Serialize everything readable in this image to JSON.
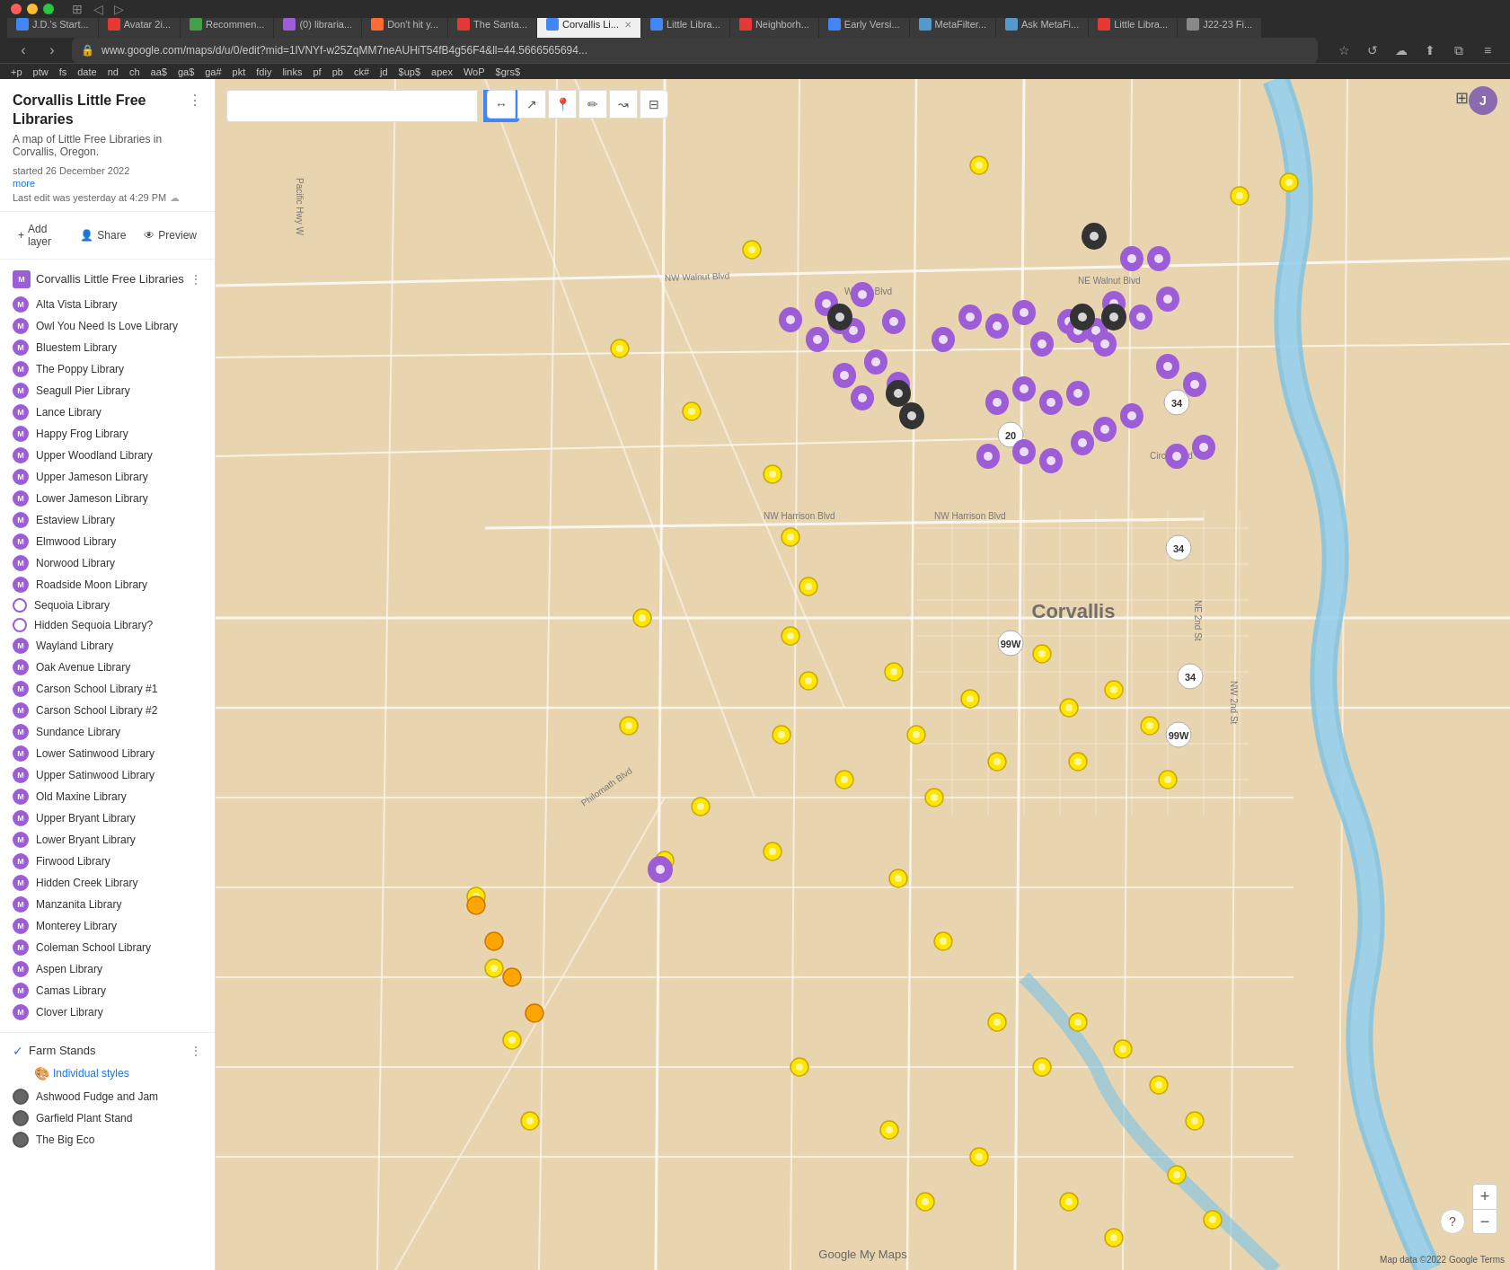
{
  "browser": {
    "tabs": [
      {
        "label": "J.D.'s Start...",
        "active": false,
        "color": "#4285f4"
      },
      {
        "label": "Avatar 2i...",
        "active": false,
        "color": "#e53935"
      },
      {
        "label": "Recommen...",
        "active": false,
        "color": "#43a047"
      },
      {
        "label": "(0) libraria...",
        "active": false,
        "color": "#9c5dd7"
      },
      {
        "label": "Don't hit y...",
        "active": false,
        "color": "#ff6b35"
      },
      {
        "label": "The Santa...",
        "active": false,
        "color": "#e53935"
      },
      {
        "label": "Corvallis Li...",
        "active": true,
        "color": "#4285f4"
      },
      {
        "label": "Little Libra...",
        "active": false,
        "color": "#4285f4"
      },
      {
        "label": "Neighborh...",
        "active": false,
        "color": "#e53935"
      },
      {
        "label": "Early Versi...",
        "active": false,
        "color": "#4285f4"
      },
      {
        "label": "MetaFilter...",
        "active": false,
        "color": "#5599cc"
      },
      {
        "label": "Ask MetaFi...",
        "active": false,
        "color": "#5599cc"
      },
      {
        "label": "Little Libra...",
        "active": false,
        "color": "#e53935"
      },
      {
        "label": "J22-23 Fi...",
        "active": false,
        "color": "#888"
      }
    ],
    "address": "www.google.com/maps/d/u/0/edit?mid=1lVNYf-w25ZqMM7neAUHiT54fB4g56F4&ll=44.5666565694...",
    "bookmarks": [
      "+p",
      "ptw",
      "fs",
      "date",
      "nd",
      "ch",
      "aa$",
      "ga$",
      "ga#",
      "pkt",
      "fdiy",
      "links",
      "pf",
      "pb",
      "ck#",
      "jd",
      "$up$",
      "apex",
      "WoP",
      "$grs$"
    ]
  },
  "sidebar": {
    "title": "Corvallis Little Free Libraries",
    "description": "A map of Little Free Libraries in Corvallis, Oregon.",
    "started": "started 26 December 2022",
    "more_label": "more",
    "last_edit": "Last edit was yesterday at 4:29 PM",
    "add_layer_label": "Add layer",
    "share_label": "Share",
    "preview_label": "Preview",
    "layer_title": "Corvallis Little Free Libraries",
    "libraries": [
      {
        "label": "Alta Vista Library",
        "icon": "M"
      },
      {
        "label": "Owl You Need Is Love Library",
        "icon": "M"
      },
      {
        "label": "Bluestem Library",
        "icon": "M"
      },
      {
        "label": "The Poppy Library",
        "icon": "M"
      },
      {
        "label": "Seagull Pier Library",
        "icon": "M"
      },
      {
        "label": "Lance Library",
        "icon": "M"
      },
      {
        "label": "Happy Frog Library",
        "icon": "M"
      },
      {
        "label": "Upper Woodland Library",
        "icon": "M"
      },
      {
        "label": "Upper Jameson Library",
        "icon": "M"
      },
      {
        "label": "Lower Jameson Library",
        "icon": "M"
      },
      {
        "label": "Estaview Library",
        "icon": "M"
      },
      {
        "label": "Elmwood Library",
        "icon": "M"
      },
      {
        "label": "Norwood Library",
        "icon": "M"
      },
      {
        "label": "Roadside Moon Library",
        "icon": "M"
      },
      {
        "label": "Sequoia Library",
        "icon": "circle"
      },
      {
        "label": "Hidden Sequoia Library?",
        "icon": "circle"
      },
      {
        "label": "Wayland Library",
        "icon": "M"
      },
      {
        "label": "Oak Avenue Library",
        "icon": "M"
      },
      {
        "label": "Carson School Library #1",
        "icon": "M"
      },
      {
        "label": "Carson School Library #2",
        "icon": "M"
      },
      {
        "label": "Sundance Library",
        "icon": "M"
      },
      {
        "label": "Lower Satinwood Library",
        "icon": "M"
      },
      {
        "label": "Upper Satinwood Library",
        "icon": "M"
      },
      {
        "label": "Old Maxine Library",
        "icon": "M"
      },
      {
        "label": "Upper Bryant Library",
        "icon": "M"
      },
      {
        "label": "Lower Bryant Library",
        "icon": "M"
      },
      {
        "label": "Firwood Library",
        "icon": "M"
      },
      {
        "label": "Hidden Creek Library",
        "icon": "M"
      },
      {
        "label": "Manzanita Library",
        "icon": "M"
      },
      {
        "label": "Monterey Library",
        "icon": "M"
      },
      {
        "label": "Coleman School Library",
        "icon": "M"
      },
      {
        "label": "Aspen Library",
        "icon": "M"
      },
      {
        "label": "Camas Library",
        "icon": "M"
      },
      {
        "label": "Clover Library",
        "icon": "M"
      }
    ],
    "farm_stands": {
      "title": "Farm Stands",
      "individual_styles_label": "Individual styles",
      "items": [
        {
          "label": "Ashwood Fudge and Jam"
        },
        {
          "label": "Garfield Plant Stand"
        },
        {
          "label": "The Big Eco"
        }
      ]
    }
  },
  "map": {
    "search_placeholder": "",
    "search_icon": "🔍",
    "logo": "Google My Maps",
    "attribution": "Map data ©2022 Google  Terms",
    "zoom_in": "+",
    "zoom_out": "−",
    "help": "?"
  }
}
